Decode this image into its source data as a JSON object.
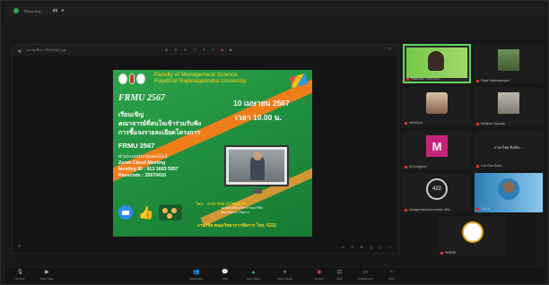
{
  "window": {
    "title": "Recording...",
    "controls": [
      "▮▮",
      "■"
    ]
  },
  "share": {
    "file_name": "ประชุมชี้แจง FRMU2567.jpg",
    "tools": [
      "⊕",
      "⊖",
      "⟲",
      "▢",
      "✎",
      "✐",
      "■",
      "■",
      "…"
    ],
    "bottom_controls": [
      "▭",
      "⊖",
      "⊕",
      "◫",
      "◻",
      "⤢"
    ]
  },
  "slide": {
    "faculty_line1": "Faculty of Management Science",
    "faculty_line2": "Rajabhat Rajanagarindra University",
    "event": "FRMU 2567",
    "date": "10 เมษายน 2567",
    "time": "เวลา 10.00 น.",
    "invite_line1": "เรียนเชิญ",
    "invite_line2": "คณาจารย์ที่สนใจเข้าร่วมรับฟัง",
    "invite_line3": "การชี้แจงรายละเอียดโครงการ",
    "frmu": "FRMU 2567",
    "info_line1": "ผ่านระบบประชุมออนไลน์",
    "info_line2": "Zoom Cloud Meeting",
    "info_line3": "Meeting ID : 913 3693 5957",
    "info_line4": "Passcode : 25670410",
    "sign": "โดย... อ.ดร.ชนัต ตำไซ้ดูมาร",
    "sign_sub1": "รองคณบดีฝ่ายวิชาการและวิจัย",
    "sign_sub2": "คณะวิทยาการจัดการ",
    "footer": "งานวิจัย คณะวิทยาการจัดการ โทร. 6211"
  },
  "gallery": {
    "tiles": [
      {
        "name": "Passcode : 25670410 ...",
        "kind": "active"
      },
      {
        "name": "Piyad Rattanapongsa",
        "kind": "photo-green"
      },
      {
        "name": "ชนัตต์นงค์",
        "kind": "photo-face"
      },
      {
        "name": "Suthinart Supanan",
        "kind": "photo-grey"
      },
      {
        "name": "M.Duangporn",
        "kind": "avatar",
        "letter": "M"
      },
      {
        "name": "ภาษาไทย ยิ่งชัยะ",
        "kind": "text",
        "label": "ภาษาไทย ยิ่งชัยะ..."
      },
      {
        "name": "ManagementUmnmumsis. MSc",
        "kind": "round",
        "label": "422"
      },
      {
        "name": "ปิยมาศ",
        "kind": "woman"
      },
      {
        "name": "FMRMS",
        "kind": "fmu"
      }
    ]
  },
  "toolbar": {
    "left": [
      {
        "icon": "🎙",
        "label": "Unmute"
      },
      {
        "icon": "▶",
        "label": "Start Video"
      }
    ],
    "center": [
      {
        "icon": "👥",
        "label": "Participants",
        "color": ""
      },
      {
        "icon": "💬",
        "label": "Chat",
        "color": ""
      },
      {
        "icon": "▲",
        "label": "New Share",
        "color": "green"
      },
      {
        "icon": "⏸",
        "label": "Pause Share",
        "color": ""
      },
      {
        "icon": "◉",
        "label": "Record",
        "color": "red"
      },
      {
        "icon": "⊡",
        "label": "Apps",
        "color": ""
      },
      {
        "icon": "▭",
        "label": "Whiteboards",
        "color": ""
      },
      {
        "icon": "⋯",
        "label": "More",
        "color": ""
      }
    ]
  }
}
